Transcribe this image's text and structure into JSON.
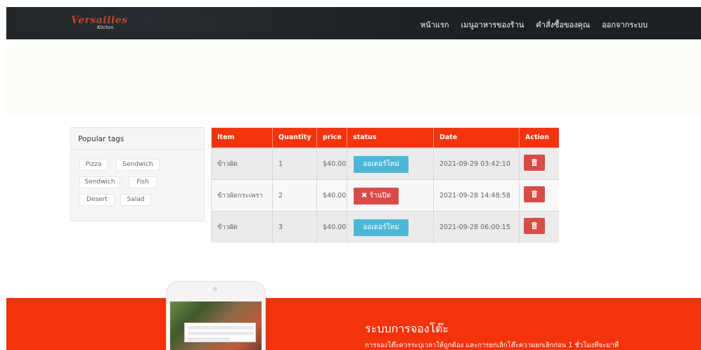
{
  "navbar": {
    "logo": {
      "main": "Versailles",
      "sub": "Kitchen"
    },
    "links": [
      "หน้าแรก",
      "เมนูอาหารของร้าน",
      "คำสั่งซื้อของคุณ",
      "ออกจากระบบ"
    ]
  },
  "sidebar": {
    "title": "Popular tags",
    "tags": [
      "Pizza",
      "Sendwich",
      "Sendwich",
      "Fish",
      "Desert",
      "Salad"
    ]
  },
  "orders": {
    "headers": [
      "Item",
      "Quantity",
      "price",
      "status",
      "Date",
      "Action"
    ],
    "rows": [
      {
        "item": "ข้าวผัด",
        "quantity": "1",
        "price": "$40.00",
        "status": "ออเดอร์ใหม่",
        "status_type": "new",
        "date": "2021-09-29 03:42:10",
        "action_icon": "trash-icon"
      },
      {
        "item": "ข้าวผัดกระเพรา",
        "quantity": "2",
        "price": "$40.00",
        "status": "ร้านปิด",
        "status_type": "closed",
        "date": "2021-09-28 14:48:58",
        "action_icon": "trash-icon"
      },
      {
        "item": "ข้าวผัด",
        "quantity": "3",
        "price": "$40.00",
        "status": "ออเดอร์ใหม่",
        "status_type": "new",
        "date": "2021-09-28 06:00:15",
        "action_icon": "trash-icon"
      }
    ],
    "closed_icon": "x-icon"
  },
  "footer": {
    "title": "ระบบการจองโต๊ะ",
    "text": "การจองโต๊ะควรระบุเวลาให้ถูกต้อง และการยกเลิกโต๊ะความยกเลิกก่อน 1 ชั่วโมงที่จะมาที่"
  },
  "colors": {
    "accent": "#f3330c",
    "navbar": "#1c2024",
    "status_new": "#4bb8d8",
    "status_closed": "#d84c48"
  }
}
